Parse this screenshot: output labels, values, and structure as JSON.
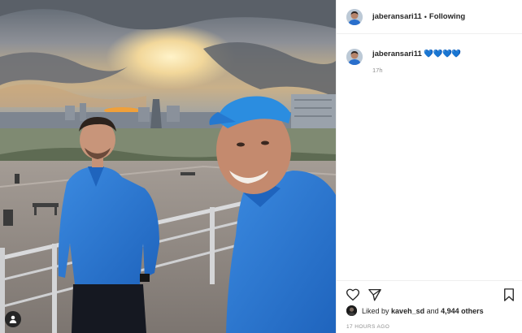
{
  "post": {
    "username": "jaberansari11",
    "follow_label": "Following",
    "separator": "•",
    "caption": {
      "username": "jaberansari11",
      "emoji": "💙💙💙💙",
      "time": "17h"
    },
    "likes": {
      "prefix": "Liked by",
      "liker": "kaveh_sd",
      "connector": "and",
      "others": "4,944 others"
    },
    "timestamp": "17 HOURS AGO"
  },
  "icons": {
    "like": "heart-outline-icon",
    "share": "paper-plane-icon",
    "save": "bookmark-icon",
    "tag": "person-tag-icon"
  },
  "colors": {
    "jacket": "#2a7bd6",
    "cap": "#2b8de0",
    "hearts": "#2ec4dc",
    "muted_text": "#8e8e8e"
  }
}
